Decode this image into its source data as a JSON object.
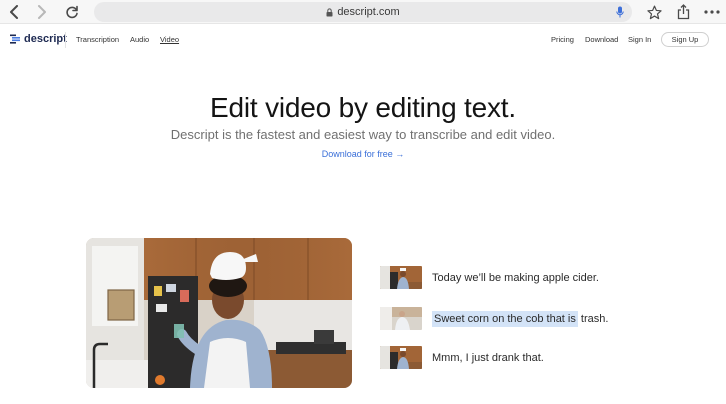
{
  "browser": {
    "url": "descript.com",
    "icons": [
      "back-icon",
      "forward-icon",
      "reload-icon",
      "lock-icon",
      "mic-icon",
      "bookmark-star-icon",
      "share-icon",
      "more-icon"
    ]
  },
  "nav": {
    "brand": "descript",
    "links": {
      "transcription": "Transcription",
      "audio": "Audio",
      "video": "Video"
    },
    "right": {
      "pricing": "Pricing",
      "download": "Download",
      "signin": "Sign In",
      "signup": "Sign Up"
    }
  },
  "hero": {
    "title": "Edit video by editing text.",
    "subtitle": "Descript is the fastest and easiest way to transcribe and edit video.",
    "cta": "Download for free →"
  },
  "transcript": {
    "line1": "Today we’ll be making apple cider.",
    "line2_highlight": "Sweet corn on the cob that is",
    "line2_rest": " trash.",
    "line3": "Mmm, I just drank that."
  },
  "colors": {
    "link": "#3a6fd8",
    "highlight": "#d3e3f7",
    "brand": "#1e2a52"
  }
}
